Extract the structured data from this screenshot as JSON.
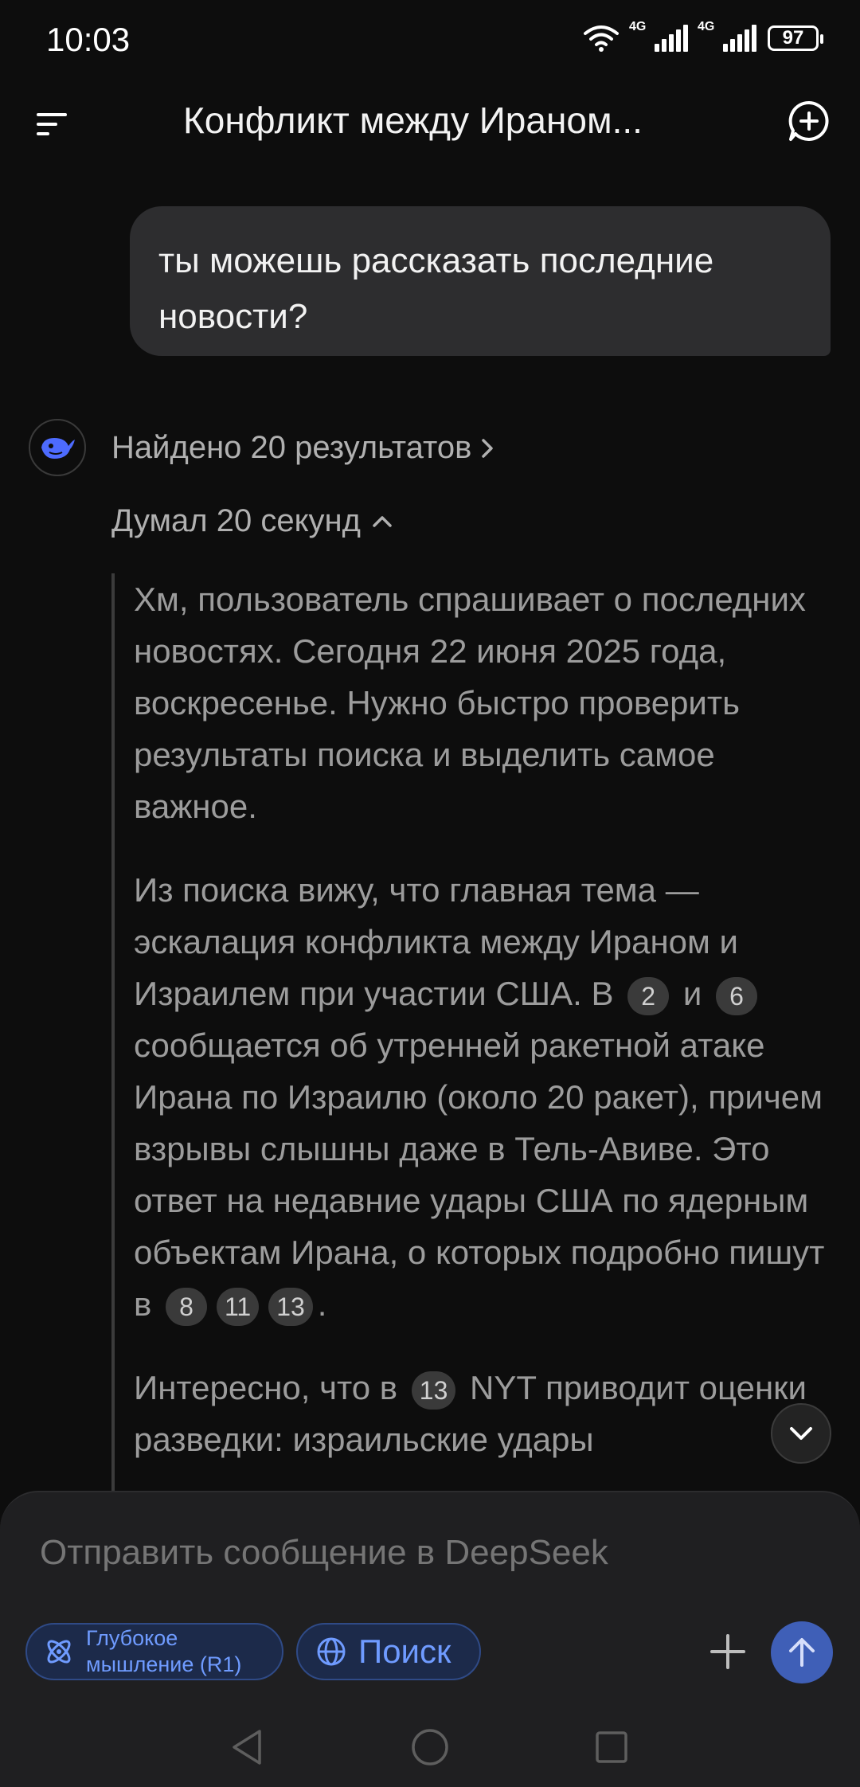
{
  "status_bar": {
    "time": "10:03",
    "net1": "4G",
    "net2": "4G",
    "battery": "97"
  },
  "header": {
    "title": "Конфликт между Ираном..."
  },
  "user_message": {
    "text": "ты можешь рассказать последние новости?"
  },
  "assistant": {
    "search_results": "Найдено 20 результатов",
    "thinking": "Думал 20 секунд",
    "p1": "Хм, пользователь спрашивает о последних новостях. Сегодня 22 июня 2025 года, воскресенье. Нужно быстро проверить результаты поиска и выделить самое важное.",
    "p2_a": "Из поиска вижу, что главная тема — эскалация конфликта между Ираном и Израилем при участии США. В",
    "p2_c1": "2",
    "p2_b": "и",
    "p2_c2": "6",
    "p2_c": "сообщается об утренней ракетной атаке Ирана по Израилю (около 20 ракет), причем взрывы слышны даже в Тель-Авиве. Это ответ на недавние удары США по ядерным объектам Ирана, о которых подробно пишут в",
    "p2_c3": "8",
    "p2_c4": "11",
    "p2_c5": "13",
    "p2_end": ".",
    "p3_a": "Интересно, что в",
    "p3_c1": "13",
    "p3_b": "NYT приводит оценки разведки: израильские удары"
  },
  "composer": {
    "placeholder": "Отправить сообщение в DeepSeek",
    "deep_think": "Глубокое мышление (R1)",
    "search": "Поиск"
  },
  "colors": {
    "background": "#0d0d0d",
    "bubble": "#2d2d2f",
    "accent": "#6f9bff",
    "send": "#3f5fb7"
  },
  "icons": {
    "menu": "menu-icon",
    "new_chat": "new-chat-icon",
    "avatar": "deepseek-whale-icon",
    "scroll": "chevron-down-icon",
    "atom": "atom-icon",
    "globe": "globe-icon",
    "plus": "plus-icon",
    "send": "arrow-up-icon"
  }
}
